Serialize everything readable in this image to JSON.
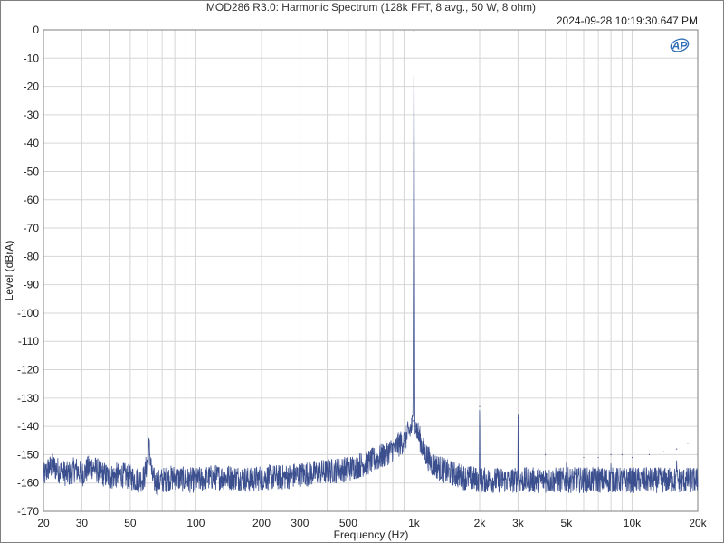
{
  "chart_data": {
    "type": "line",
    "title": "MOD286 R3.0: Harmonic Spectrum (128k FFT, 8 avg., 50 W, 8 ohm)",
    "timestamp": "2024-09-28 10:19:30.647 PM",
    "logo": "AP",
    "xlabel": "Frequency (Hz)",
    "ylabel": "Level (dBrA)",
    "xscale": "log",
    "xlim": [
      20,
      20000
    ],
    "ylim": [
      -170,
      0
    ],
    "grid": true,
    "x_ticks": [
      {
        "value": 20,
        "label": "20"
      },
      {
        "value": 30,
        "label": "30"
      },
      {
        "value": 50,
        "label": "50"
      },
      {
        "value": 100,
        "label": "100"
      },
      {
        "value": 200,
        "label": "200"
      },
      {
        "value": 300,
        "label": "300"
      },
      {
        "value": 500,
        "label": "500"
      },
      {
        "value": 1000,
        "label": "1k"
      },
      {
        "value": 2000,
        "label": "2k"
      },
      {
        "value": 3000,
        "label": "3k"
      },
      {
        "value": 5000,
        "label": "5k"
      },
      {
        "value": 10000,
        "label": "10k"
      },
      {
        "value": 20000,
        "label": "20k"
      }
    ],
    "y_ticks": [
      0,
      -10,
      -20,
      -30,
      -40,
      -50,
      -60,
      -70,
      -80,
      -90,
      -100,
      -110,
      -120,
      -130,
      -140,
      -150,
      -160,
      -170
    ],
    "series": [
      {
        "color": "#3b4f8f",
        "x": [
          20,
          21,
          22,
          24,
          26,
          28,
          30,
          33,
          36,
          40,
          45,
          50,
          55,
          58,
          60,
          61,
          62,
          63,
          66,
          70,
          80,
          90,
          100,
          120,
          150,
          180,
          200,
          250,
          300,
          400,
          500,
          600,
          700,
          800,
          900,
          950,
          980,
          990,
          1000,
          1010,
          1020,
          1050,
          1100,
          1200,
          1400,
          1700,
          1990,
          2000,
          2010,
          2500,
          2990,
          3000,
          3010,
          3500,
          3990,
          4000,
          4010,
          4500,
          4990,
          5000,
          5010,
          5500,
          5990,
          6000,
          6010,
          6990,
          7000,
          7010,
          7990,
          8000,
          8010,
          8990,
          9000,
          9010,
          9990,
          10000,
          10010,
          11990,
          12000,
          12010,
          13990,
          14000,
          14010,
          15990,
          16000,
          16010,
          17990,
          18000,
          18010,
          19000,
          20000
        ],
        "y": [
          -158,
          -155,
          -154,
          -156,
          -157,
          -155,
          -157,
          -154,
          -156,
          -158,
          -157,
          -158,
          -159,
          -158,
          -152,
          -147,
          -152,
          -158,
          -160,
          -159,
          -158,
          -159,
          -159,
          -158,
          -158,
          -159,
          -158,
          -158,
          -157,
          -156,
          -155,
          -153,
          -151,
          -148,
          -145,
          -142,
          -140,
          -138,
          -0.5,
          -138,
          -140,
          -143,
          -148,
          -153,
          -156,
          -158,
          -159,
          -133,
          -159,
          -159,
          -159,
          -137,
          -159,
          -159,
          -159,
          -150,
          -159,
          -159,
          -159,
          -149,
          -159,
          -159,
          -159,
          -151,
          -159,
          -159,
          -151,
          -159,
          -159,
          -150,
          -159,
          -159,
          -150,
          -159,
          -159,
          -151,
          -159,
          -159,
          -150,
          -159,
          -159,
          -149,
          -159,
          -159,
          -148,
          -159,
          -159,
          -146,
          -159,
          -159,
          -159
        ]
      }
    ]
  }
}
